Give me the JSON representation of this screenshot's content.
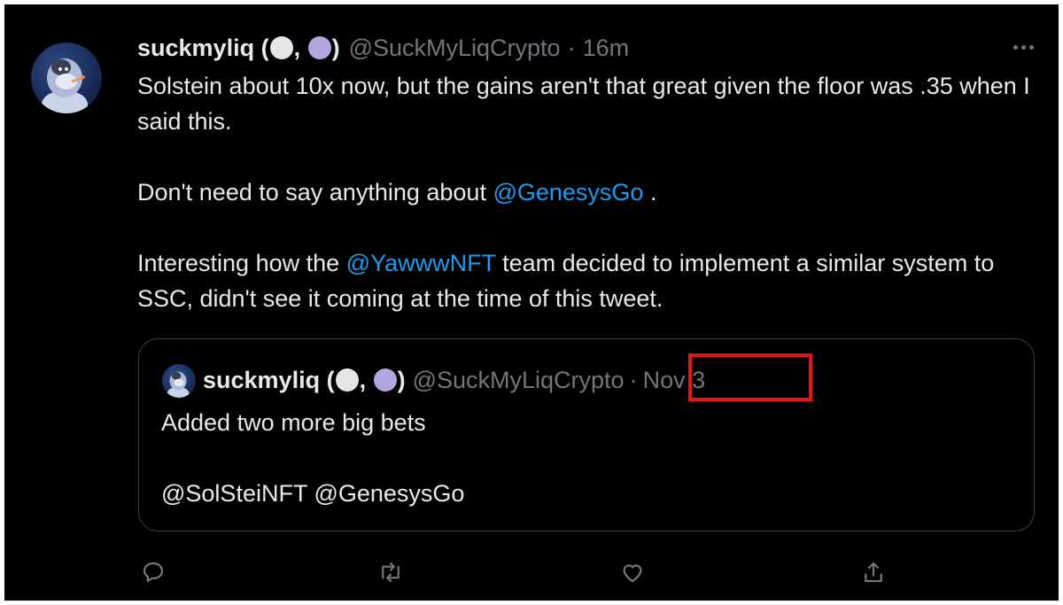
{
  "tweet": {
    "author": {
      "display_name": "suckmyliq",
      "handle": "@SuckMyLiqCrypto"
    },
    "separator": "·",
    "time": "16m",
    "body": {
      "line1": "Solstein about 10x now, but the gains aren't that great given the floor was .35 when I said this.",
      "line2_prefix": "Don't need to say anything about ",
      "line2_mention": "@GenesysGo",
      "line2_suffix": " .",
      "line3_prefix": "Interesting how the ",
      "line3_mention": "@YawwwNFT",
      "line3_suffix": " team decided to implement a similar system to SSC, didn't see it coming at the time of this tweet."
    },
    "quoted": {
      "display_name": "suckmyliq",
      "handle": "@SuckMyLiqCrypto",
      "separator": "·",
      "date": "Nov 3",
      "text_line1": "Added two more big bets",
      "text_line2": "@SolSteiNFT @GenesysGo"
    },
    "actions": [
      {
        "icon": "reply-icon"
      },
      {
        "icon": "retweet-icon"
      },
      {
        "icon": "like-icon"
      },
      {
        "icon": "share-icon"
      }
    ],
    "more_icon": "more-options-icon"
  },
  "annotation": {
    "highlight_color": "#e0161b"
  },
  "colors": {
    "background": "#000000",
    "text": "#e7e9ea",
    "muted": "#71767b",
    "link": "#1d9bf0",
    "border": "#3a3f44"
  }
}
